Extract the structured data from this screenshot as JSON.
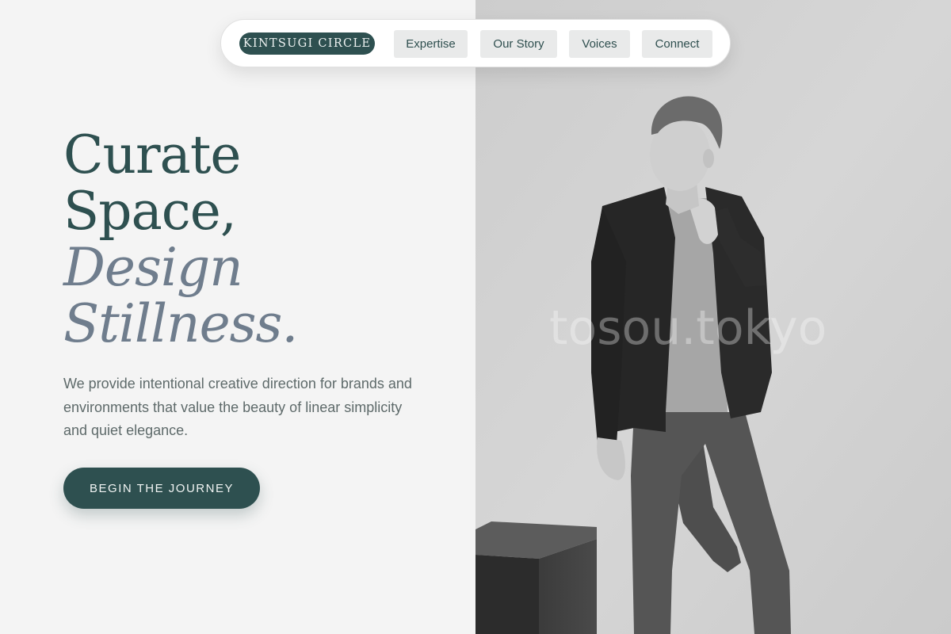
{
  "nav": {
    "brand": "KINTSUGI CIRCLE",
    "links": [
      "Expertise",
      "Our Story",
      "Voices",
      "Connect"
    ]
  },
  "hero": {
    "headline": [
      "Curate",
      "Space,",
      "Design",
      "Stillness."
    ],
    "description": "We provide intentional creative direction for brands and environments that value the beauty of linear simplicity and quiet elegance.",
    "cta_label": "BEGIN THE JOURNEY"
  },
  "image": {
    "watermark": "tosou.tokyo"
  },
  "colors": {
    "accent": "#2e5050",
    "headline_italic": "#6f7d8d",
    "background": "#f4f4f4",
    "body_text": "#5e6a6a"
  }
}
